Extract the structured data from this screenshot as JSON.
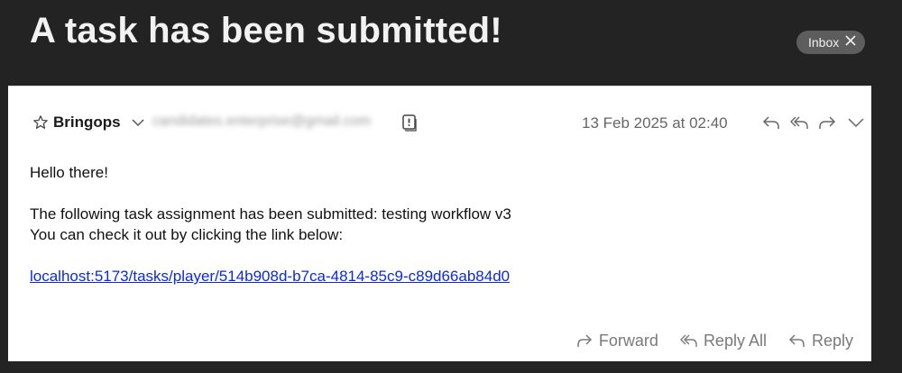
{
  "message": {
    "subject": "A task has been submitted!",
    "mailbox_badge": "Inbox",
    "sender_name": "Bringops",
    "sender_address": "candidates.enterprise@gmail.com",
    "date": "13 Feb 2025 at 02:40"
  },
  "body": {
    "greeting": "Hello there!",
    "line1": "The following task assignment has been submitted: testing workflow v3",
    "line2": "You can check it out by clicking the link below:",
    "link": "localhost:5173/tasks/player/514b908d-b7ca-4814-85c9-c89d66ab84d0"
  },
  "footer": {
    "forward": "Forward",
    "reply_all": "Reply All",
    "reply": "Reply"
  },
  "icons": {
    "star": "star-icon",
    "chevron": "chevron-down-icon",
    "note": "note-icon",
    "reply": "reply-icon",
    "reply_all": "reply-all-icon",
    "forward": "forward-icon",
    "close": "close-icon"
  },
  "colors": {
    "background": "#232323",
    "card": "#ffffff",
    "link": "#0b2bd6",
    "badge": "#5d5d5d"
  }
}
